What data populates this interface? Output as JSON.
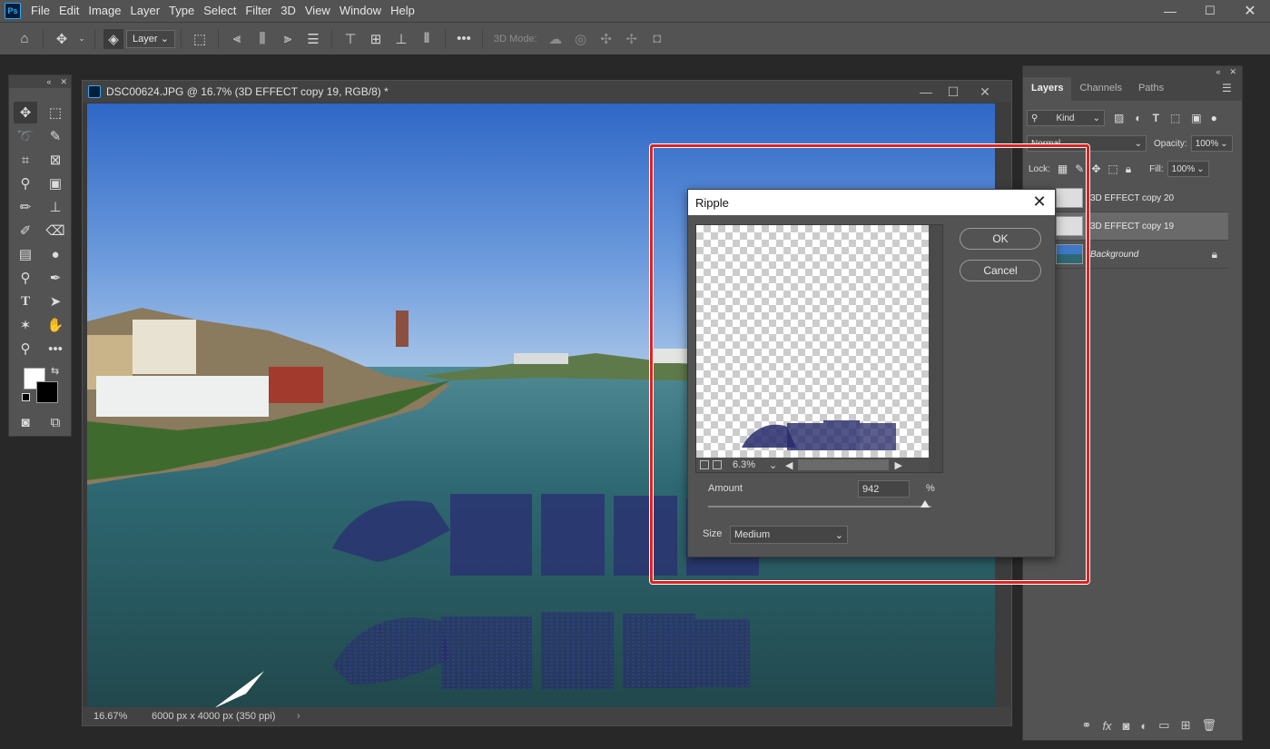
{
  "app": {
    "logo": "Ps"
  },
  "menu": [
    "File",
    "Edit",
    "Image",
    "Layer",
    "Type",
    "Select",
    "Filter",
    "3D",
    "View",
    "Window",
    "Help"
  ],
  "options_bar": {
    "layer_select": "Layer",
    "mode_3d_label": "3D Mode:"
  },
  "document": {
    "title": "DSC00624.JPG @ 16.7% (3D EFFECT copy 19, RGB/8) *",
    "zoom": "16.67%",
    "dimensions": "6000 px x 4000 px (350 ppi)"
  },
  "colors": {
    "foreground": "#ffffff",
    "background": "#000000",
    "highlight": "#e02020",
    "text_effect": "#272a6a"
  },
  "layers_panel": {
    "tabs": [
      "Layers",
      "Channels",
      "Paths"
    ],
    "filter_kind": "Kind",
    "blend_mode": "Normal",
    "opacity_label": "Opacity:",
    "opacity_value": "100%",
    "lock_label": "Lock:",
    "fill_label": "Fill:",
    "fill_value": "100%",
    "layers": [
      {
        "name": "3D EFFECT copy 20",
        "selected": false
      },
      {
        "name": "3D EFFECT copy 19",
        "selected": true
      },
      {
        "name": "Background",
        "selected": false,
        "locked": true
      }
    ]
  },
  "ripple_dialog": {
    "title": "Ripple",
    "ok_label": "OK",
    "cancel_label": "Cancel",
    "preview_zoom": "6.3%",
    "amount_label": "Amount",
    "amount_value": "942",
    "amount_unit": "%",
    "amount_fraction": 0.97,
    "size_label": "Size",
    "size_value": "Medium"
  }
}
